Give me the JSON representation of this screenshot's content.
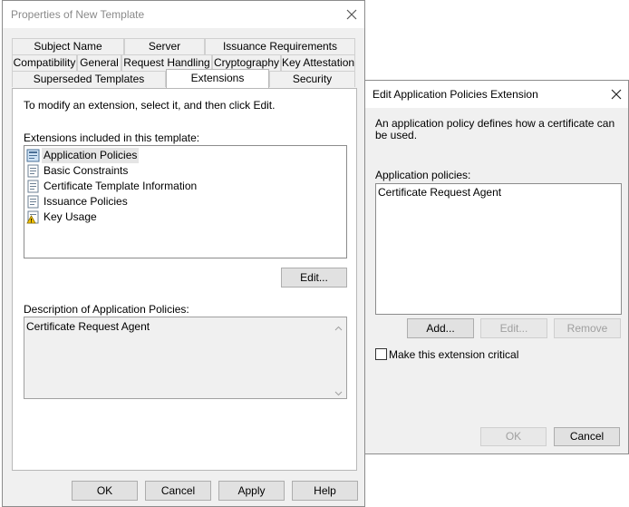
{
  "properties_dialog": {
    "title": "Properties of New Template",
    "tabs_row1": [
      "Subject Name",
      "Server",
      "Issuance Requirements"
    ],
    "tabs_row2": [
      "Compatibility",
      "General",
      "Request Handling",
      "Cryptography",
      "Key Attestation"
    ],
    "tabs_row3": [
      "Superseded Templates",
      "Extensions",
      "Security"
    ],
    "active_tab": "Extensions",
    "instruction": "To modify an extension, select it, and then click Edit.",
    "extensions_label": "Extensions included in this template:",
    "extensions": [
      {
        "label": "Application Policies",
        "icon": "certificate-icon",
        "selected": true
      },
      {
        "label": "Basic Constraints",
        "icon": "document-icon",
        "selected": false
      },
      {
        "label": "Certificate Template Information",
        "icon": "document-icon",
        "selected": false
      },
      {
        "label": "Issuance Policies",
        "icon": "document-icon",
        "selected": false
      },
      {
        "label": "Key Usage",
        "icon": "warning-document-icon",
        "selected": false
      }
    ],
    "edit_button": "Edit...",
    "description_label": "Description of Application Policies:",
    "description_text": "Certificate Request Agent",
    "buttons": {
      "ok": "OK",
      "cancel": "Cancel",
      "apply": "Apply",
      "help": "Help"
    }
  },
  "edit_dialog": {
    "title": "Edit Application Policies Extension",
    "description": "An application policy defines how a certificate can be used.",
    "policies_label": "Application policies:",
    "policies": [
      "Certificate Request Agent"
    ],
    "add_button": "Add...",
    "edit_button": "Edit...",
    "remove_button": "Remove",
    "critical_checkbox_label": "Make this extension critical",
    "critical_checked": false,
    "ok_button": "OK",
    "cancel_button": "Cancel"
  }
}
